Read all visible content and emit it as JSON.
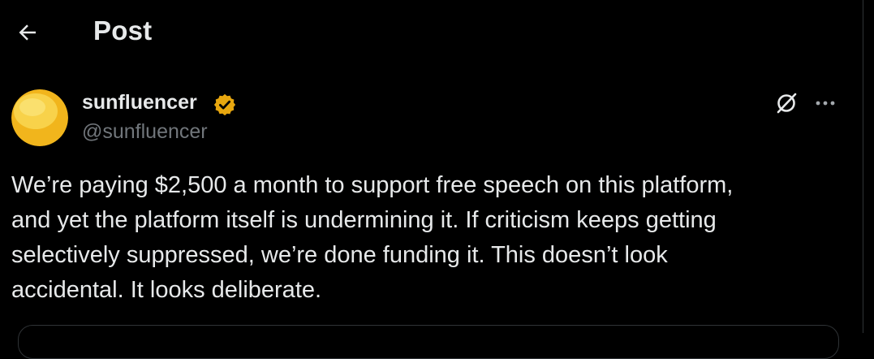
{
  "header": {
    "back_icon": "arrow-left-icon",
    "title": "Post"
  },
  "post": {
    "author": {
      "display_name": "sunfluencer",
      "handle": "@sunfluencer",
      "verified": true,
      "verified_color": "#f4b400",
      "avatar_color": "#f6c13b"
    },
    "actions": {
      "grok_icon": "grok-icon",
      "more_icon": "more-dots-icon"
    },
    "text_lines": [
      "We’re paying $2,500 a month to support free speech on this platform,",
      "and yet the platform itself is undermining it. If criticism keeps getting",
      "selectively suppressed, we’re done funding it. This doesn’t look",
      "accidental. It looks deliberate."
    ]
  },
  "colors": {
    "background": "#000000",
    "primary_text": "#e7e9ea",
    "secondary_text": "#71767b",
    "border": "#2f3336"
  }
}
